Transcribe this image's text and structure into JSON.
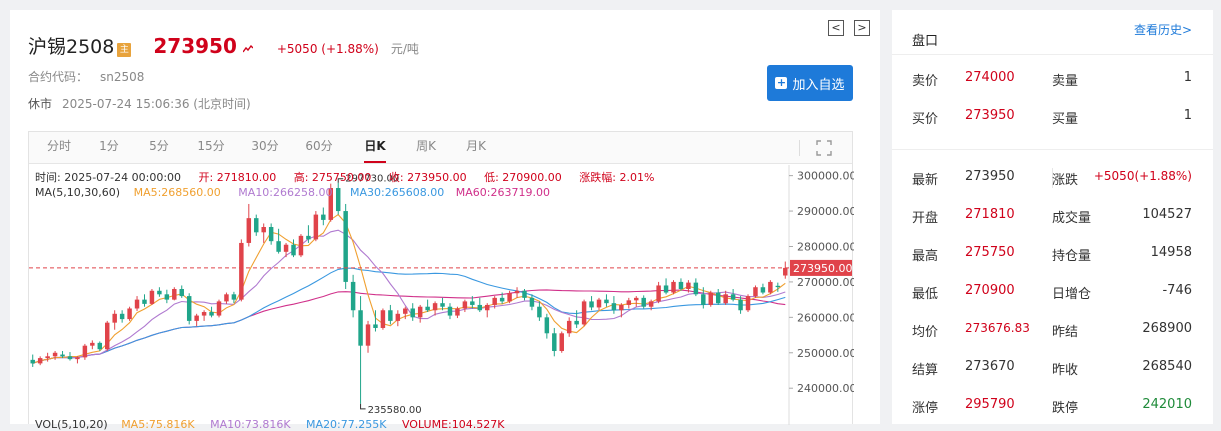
{
  "header": {
    "name": "沪锡2508",
    "badge": "主",
    "price": "273950",
    "change": "+5050 (+1.88%)",
    "unit": "元/吨",
    "code_label": "合约代码：",
    "code": "sn2508",
    "status": "休市",
    "timestamp": "2025-07-24 15:06:36 (北京时间)",
    "add_label": "加入自选",
    "prev_arrow": "<",
    "next_arrow": ">"
  },
  "tabs": [
    "分时",
    "1分",
    "5分",
    "15分",
    "30分",
    "60分",
    "日K",
    "周K",
    "月K"
  ],
  "active_tab": "日K",
  "info": {
    "time": "时间: 2025-07-24 00:00:00",
    "open": "开: 271810.00",
    "high": "高: 275750.00",
    "close": "收: 273950.00",
    "low": "低: 270900.00",
    "chg": "涨跌幅: 2.01%",
    "ma_label": "MA(5,10,30,60)",
    "ma5": "MA5:268560.00",
    "ma10": "MA10:266258.00",
    "ma30": "MA30:265608.00",
    "ma60": "MA60:263719.00",
    "max_marker": "297730.00",
    "min_marker": "235580.00",
    "last_price_tag": "273950.00",
    "vol_label": "VOL(5,10,20)",
    "vma5": "MA5:75.816K",
    "vma10": "MA10:73.816K",
    "vma20": "MA20:77.255K",
    "volume": "VOLUME:104.527K"
  },
  "colors": {
    "up": "#e0434a",
    "down": "#20a58a",
    "ma5": "#f0a030",
    "ma10": "#b07ad0",
    "ma30": "#3a98e0",
    "ma60": "#d0308a"
  },
  "chart_data": {
    "type": "candlestick",
    "y_ticks": [
      "300000.00",
      "290000.00",
      "280000.00",
      "270000.00",
      "260000.00",
      "250000.00",
      "240000.00"
    ],
    "ylim": [
      233000,
      303000
    ],
    "last_price": 273950,
    "candles": [
      [
        248000,
        249500,
        246000,
        247000
      ],
      [
        247000,
        249000,
        246500,
        248500
      ],
      [
        248500,
        250000,
        247500,
        249000
      ],
      [
        249000,
        250500,
        248000,
        250000
      ],
      [
        249500,
        250500,
        248500,
        249000
      ],
      [
        249000,
        250200,
        247800,
        248200
      ],
      [
        248200,
        249000,
        247000,
        248700
      ],
      [
        248700,
        252500,
        248000,
        252000
      ],
      [
        252000,
        253500,
        251000,
        252800
      ],
      [
        252800,
        253200,
        250500,
        251000
      ],
      [
        251000,
        259000,
        250500,
        258500
      ],
      [
        258500,
        262000,
        256500,
        261000
      ],
      [
        261000,
        262000,
        258500,
        259500
      ],
      [
        259500,
        263000,
        259000,
        262500
      ],
      [
        262500,
        266000,
        261800,
        265000
      ],
      [
        265000,
        266500,
        263000,
        263800
      ],
      [
        263800,
        268000,
        263500,
        267500
      ],
      [
        267500,
        268500,
        265800,
        266500
      ],
      [
        266500,
        267800,
        264000,
        265000
      ],
      [
        265000,
        268500,
        264800,
        268000
      ],
      [
        268000,
        269000,
        265500,
        266000
      ],
      [
        266000,
        266800,
        258000,
        259000
      ],
      [
        259000,
        261000,
        257500,
        260500
      ],
      [
        260500,
        262000,
        259000,
        261500
      ],
      [
        261500,
        263000,
        260000,
        260500
      ],
      [
        260500,
        265000,
        260000,
        264500
      ],
      [
        264500,
        267000,
        263800,
        266500
      ],
      [
        266500,
        267200,
        264000,
        265000
      ],
      [
        265000,
        282000,
        264500,
        281000
      ],
      [
        281000,
        292000,
        280000,
        288000
      ],
      [
        288000,
        289000,
        283000,
        284000
      ],
      [
        284000,
        286500,
        281000,
        285500
      ],
      [
        285500,
        286500,
        280500,
        281500
      ],
      [
        281500,
        285000,
        278000,
        278500
      ],
      [
        278500,
        281000,
        277000,
        280500
      ],
      [
        280500,
        282000,
        277000,
        277500
      ],
      [
        277500,
        283500,
        277000,
        283000
      ],
      [
        283000,
        286000,
        281000,
        282000
      ],
      [
        282000,
        290000,
        281500,
        289000
      ],
      [
        289000,
        291000,
        286000,
        287500
      ],
      [
        287500,
        297730,
        287000,
        296500
      ],
      [
        296500,
        298000,
        289000,
        290000
      ],
      [
        290000,
        292000,
        268000,
        270000
      ],
      [
        270000,
        272000,
        260000,
        262000
      ],
      [
        262000,
        266000,
        235580,
        252000
      ],
      [
        252000,
        259000,
        250000,
        258000
      ],
      [
        258000,
        262000,
        256000,
        257000
      ],
      [
        257000,
        262500,
        256500,
        262000
      ],
      [
        262000,
        263500,
        258000,
        259000
      ],
      [
        259000,
        262000,
        257500,
        261000
      ],
      [
        261000,
        263000,
        259500,
        262500
      ],
      [
        262500,
        264000,
        259000,
        260000
      ],
      [
        260000,
        263500,
        258500,
        263000
      ],
      [
        263000,
        265000,
        261500,
        262000
      ],
      [
        262000,
        264500,
        260500,
        264000
      ],
      [
        264000,
        265500,
        262000,
        263000
      ],
      [
        263000,
        264000,
        259500,
        260500
      ],
      [
        260500,
        263000,
        259800,
        262500
      ],
      [
        262500,
        265000,
        261500,
        264500
      ],
      [
        264500,
        266000,
        262500,
        263500
      ],
      [
        263500,
        265500,
        261500,
        262000
      ],
      [
        262000,
        264000,
        260000,
        263500
      ],
      [
        263500,
        266000,
        262500,
        265500
      ],
      [
        265500,
        267000,
        263800,
        264500
      ],
      [
        264500,
        267500,
        264000,
        266800
      ],
      [
        266800,
        268500,
        265500,
        267500
      ],
      [
        267500,
        268000,
        264800,
        265500
      ],
      [
        265500,
        266500,
        262000,
        263000
      ],
      [
        263000,
        264500,
        259000,
        260000
      ],
      [
        260000,
        261000,
        254000,
        255500
      ],
      [
        255500,
        257000,
        249000,
        250500
      ],
      [
        250500,
        256000,
        250000,
        255500
      ],
      [
        255500,
        260000,
        254500,
        259000
      ],
      [
        259000,
        262000,
        257000,
        258000
      ],
      [
        258000,
        265000,
        257500,
        264500
      ],
      [
        264500,
        266000,
        262000,
        262800
      ],
      [
        262800,
        265500,
        262000,
        265000
      ],
      [
        265000,
        266500,
        263000,
        264000
      ],
      [
        264000,
        266000,
        261000,
        262000
      ],
      [
        262000,
        264000,
        260000,
        263500
      ],
      [
        263500,
        265500,
        262500,
        264800
      ],
      [
        264800,
        266000,
        263000,
        265500
      ],
      [
        265500,
        266200,
        262500,
        263000
      ],
      [
        263000,
        265000,
        262000,
        264500
      ],
      [
        264500,
        270000,
        264000,
        269000
      ],
      [
        269000,
        271000,
        266500,
        267000
      ],
      [
        267000,
        270500,
        266500,
        270000
      ],
      [
        270000,
        271000,
        267500,
        268000
      ],
      [
        268000,
        270500,
        267000,
        269800
      ],
      [
        269800,
        271000,
        266000,
        266500
      ],
      [
        266500,
        268500,
        262500,
        263500
      ],
      [
        263500,
        267500,
        263000,
        267000
      ],
      [
        267000,
        268000,
        263500,
        264000
      ],
      [
        264000,
        267500,
        263500,
        266500
      ],
      [
        266500,
        268000,
        264500,
        265000
      ],
      [
        265000,
        266000,
        261000,
        262000
      ],
      [
        262000,
        266500,
        261500,
        266000
      ],
      [
        266000,
        269000,
        265500,
        268500
      ],
      [
        268500,
        269500,
        266500,
        267000
      ],
      [
        267000,
        270500,
        266500,
        270000
      ],
      [
        268900,
        269800,
        267200,
        268540
      ],
      [
        271810,
        275750,
        270900,
        273950
      ]
    ]
  },
  "panel": {
    "title": "盘口",
    "history_link": "查看历史>",
    "ask_label": "卖价",
    "ask": "274000",
    "ask_vol_label": "卖量",
    "ask_vol": "1",
    "bid_label": "买价",
    "bid": "273950",
    "bid_vol_label": "买量",
    "bid_vol": "1",
    "rows": [
      {
        "l1": "最新",
        "v1": "273950",
        "c1": "dark",
        "l2": "涨跌",
        "v2": "+5050(+1.88%)",
        "c2": "red"
      },
      {
        "l1": "开盘",
        "v1": "271810",
        "c1": "red",
        "l2": "成交量",
        "v2": "104527",
        "c2": "dark"
      },
      {
        "l1": "最高",
        "v1": "275750",
        "c1": "red",
        "l2": "持仓量",
        "v2": "14958",
        "c2": "dark"
      },
      {
        "l1": "最低",
        "v1": "270900",
        "c1": "red",
        "l2": "日增仓",
        "v2": "-746",
        "c2": "dark"
      },
      {
        "l1": "均价",
        "v1": "273676.83",
        "c1": "red",
        "l2": "昨结",
        "v2": "268900",
        "c2": "dark"
      },
      {
        "l1": "结算",
        "v1": "273670",
        "c1": "dark",
        "l2": "昨收",
        "v2": "268540",
        "c2": "dark"
      },
      {
        "l1": "涨停",
        "v1": "295790",
        "c1": "red",
        "l2": "跌停",
        "v2": "242010",
        "c2": "green"
      }
    ]
  }
}
